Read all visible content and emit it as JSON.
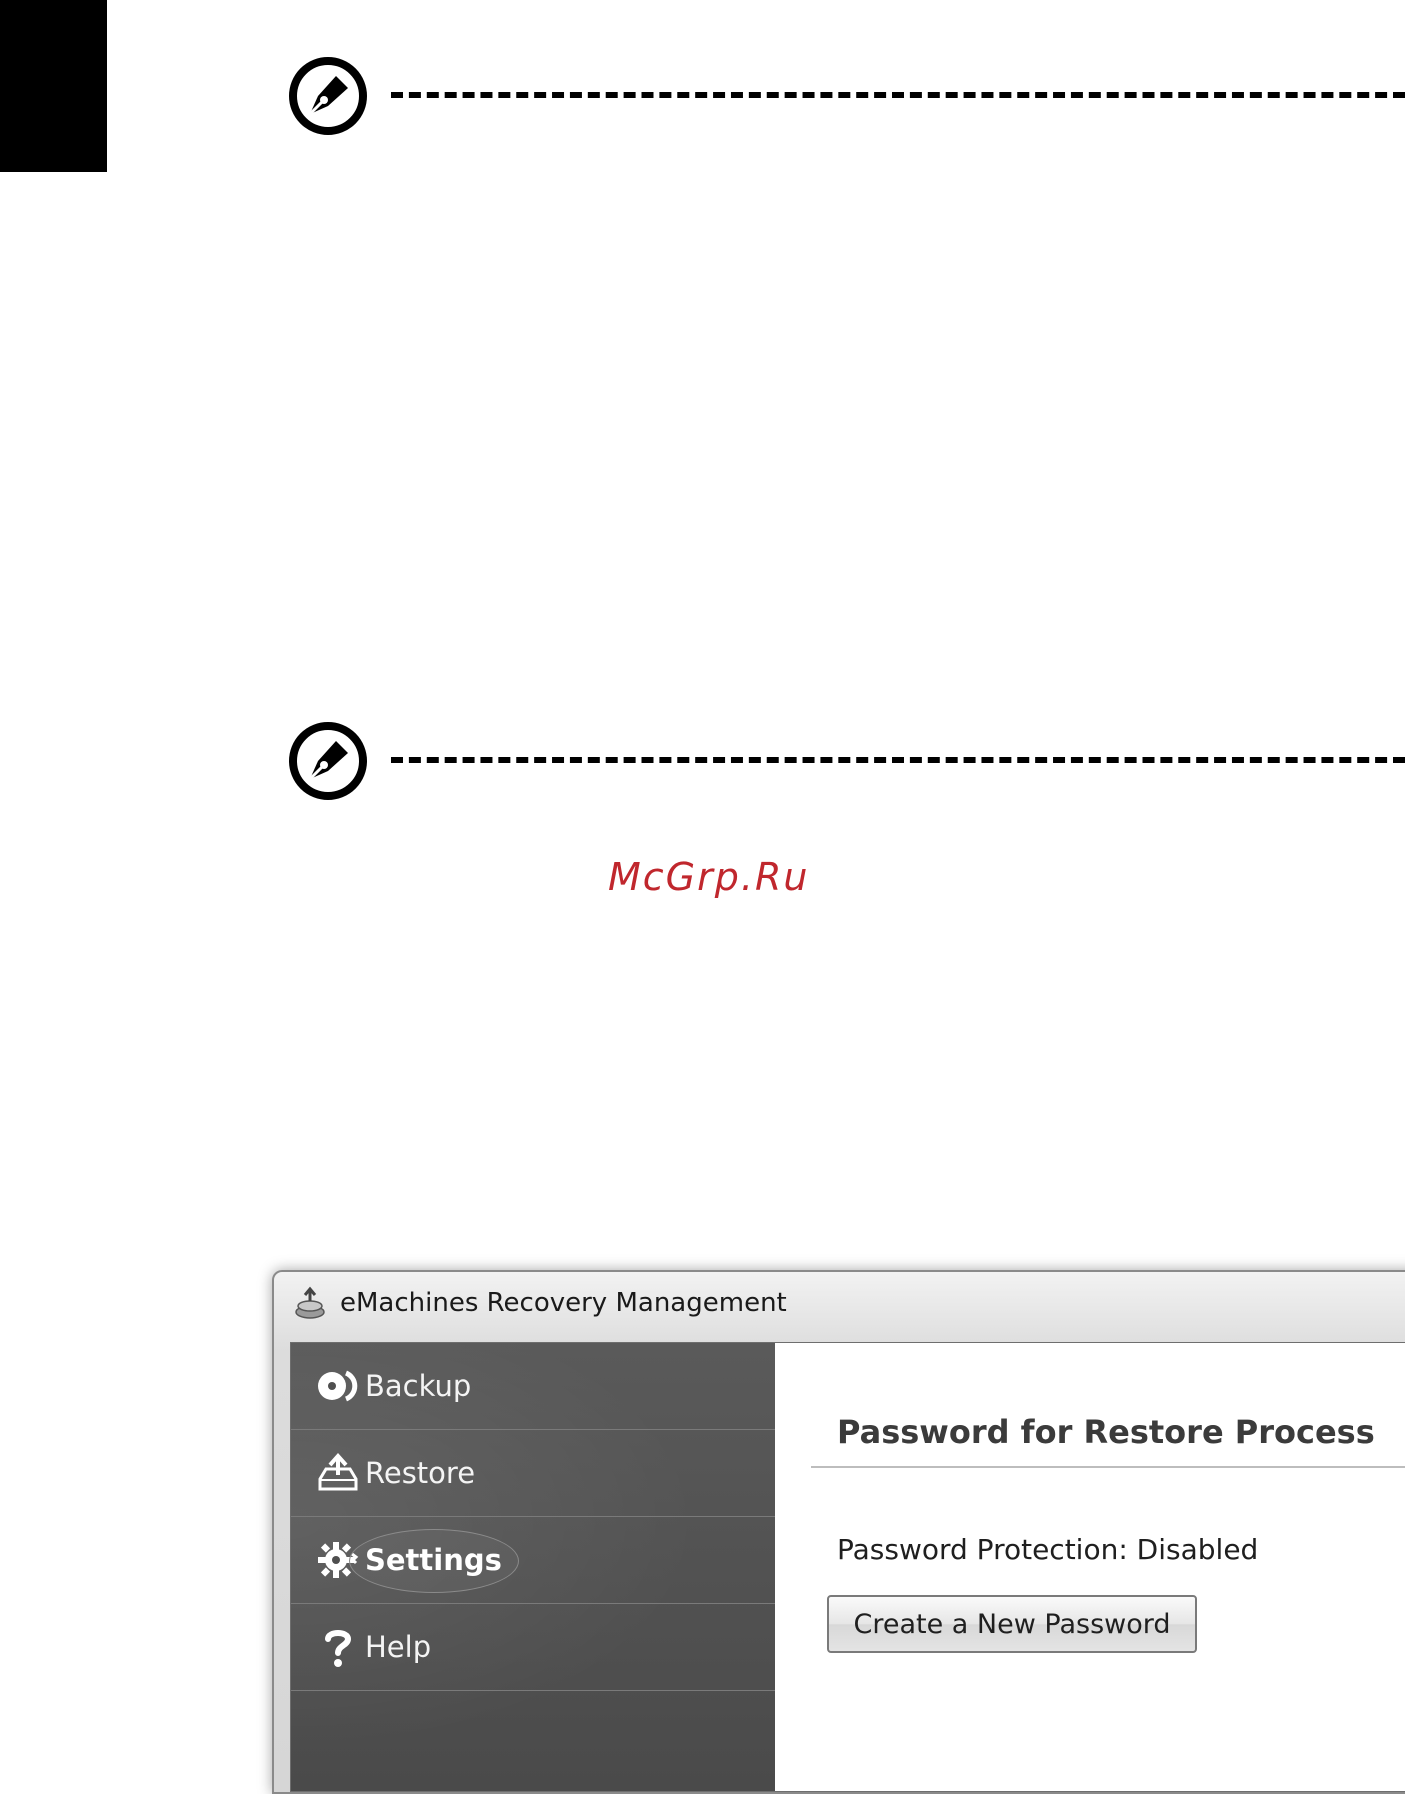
{
  "watermark": "McGrp.Ru",
  "window": {
    "title": "eMachines Recovery Management",
    "icon": "recovery-app-icon"
  },
  "sidebar": {
    "items": [
      {
        "label": "Backup",
        "icon": "backup-disc-icon"
      },
      {
        "label": "Restore",
        "icon": "restore-upload-icon"
      },
      {
        "label": "Settings",
        "icon": "gear-icon",
        "active": true
      },
      {
        "label": "Help",
        "icon": "question-mark-icon"
      }
    ]
  },
  "content": {
    "title": "Password for Restore Process",
    "status": "Password Protection: Disabled",
    "create_button": "Create a New Password"
  },
  "colors": {
    "sidebar_bg": "#4f4f4f",
    "watermark": "#c0272d",
    "page_tab": "#000000"
  },
  "note_icons": [
    "note-pen-icon",
    "note-pen-icon"
  ]
}
